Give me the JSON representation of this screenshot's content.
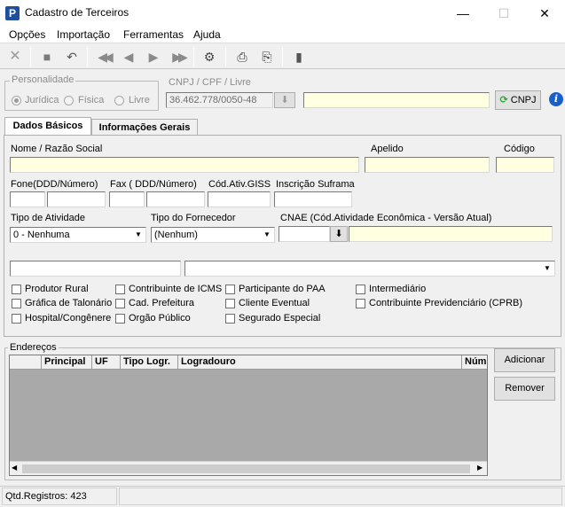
{
  "window": {
    "title": "Cadastro de Terceiros",
    "minimize": "—",
    "maximize": "☐",
    "close": "✕"
  },
  "menu": [
    "Opções",
    "Importação",
    "Ferramentas",
    "Ajuda"
  ],
  "toolbar_icons": [
    "close-x-icon",
    "stop-icon",
    "undo-icon",
    "first-icon",
    "prev-icon",
    "next-icon",
    "last-icon",
    "tools-icon",
    "print-icon",
    "print-preview-icon",
    "exit-door-icon"
  ],
  "personalidade": {
    "title": "Personalidade",
    "options": [
      "Jurídica",
      "Física",
      "Livre"
    ],
    "selected": "Jurídica"
  },
  "cnpj": {
    "label": "CNPJ / CPF / Livre",
    "value": "36.462.778/0050-48",
    "button": "CNPJ"
  },
  "tabs": [
    "Dados Básicos",
    "Informações Gerais"
  ],
  "form": {
    "nome_label": "Nome / Razão Social",
    "apelido_label": "Apelido",
    "codigo_label": "Código",
    "fone_label": "Fone(DDD/Número)",
    "fax_label": "Fax ( DDD/Número)",
    "cod_ativ_label": "Cód.Ativ.GISS",
    "inscricao_label": "Inscrição Suframa",
    "tipo_atividade_label": "Tipo de Atividade",
    "tipo_atividade_value": "0 - Nenhuma",
    "tipo_fornecedor_label": "Tipo do Fornecedor",
    "tipo_fornecedor_value": "(Nenhum)",
    "cnae_label": "CNAE (Cód.Atividade Econômica - Versão Atual)"
  },
  "checkboxes": {
    "col1": [
      "Produtor Rural",
      "Gráfica de Talonário",
      "Hospital/Congênere"
    ],
    "col2": [
      "Contribuinte de ICMS",
      "Cad. Prefeitura",
      "Orgão Público"
    ],
    "col3": [
      "Participante do PAA",
      "Cliente Eventual",
      "Segurado Especial"
    ],
    "col4": [
      "Intermediário",
      "Contribuinte Previdenciário (CPRB)"
    ]
  },
  "enderecos": {
    "title": "Endereços",
    "columns": [
      "",
      "Principal",
      "UF",
      "Tipo Logr.",
      "Logradouro",
      "Núm"
    ],
    "add_button": "Adicionar",
    "remove_button": "Remover"
  },
  "status": {
    "registros": "Qtd.Registros: 423"
  }
}
